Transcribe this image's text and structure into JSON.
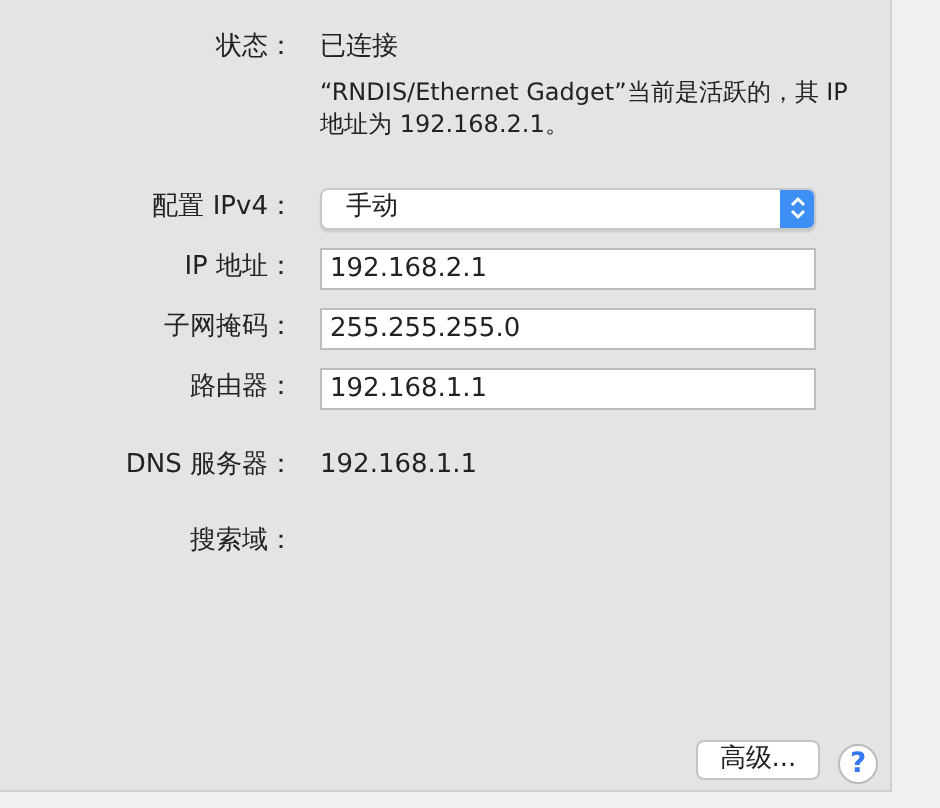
{
  "status": {
    "label": "状态：",
    "value": "已连接",
    "description": "“RNDIS/Ethernet Gadget”当前是活跃的，其 IP 地址为 192.168.2.1。"
  },
  "configure": {
    "label": "配置 IPv4：",
    "value": "手动"
  },
  "fields": [
    {
      "label": "IP 地址：",
      "value": "192.168.2.1"
    },
    {
      "label": "子网掩码：",
      "value": "255.255.255.0"
    },
    {
      "label": "路由器：",
      "value": "192.168.1.1"
    }
  ],
  "info": [
    {
      "label": "DNS 服务器：",
      "value": "192.168.1.1"
    },
    {
      "label": "搜索域："
    }
  ],
  "buttons": {
    "advanced": "高级...",
    "help": "?"
  }
}
